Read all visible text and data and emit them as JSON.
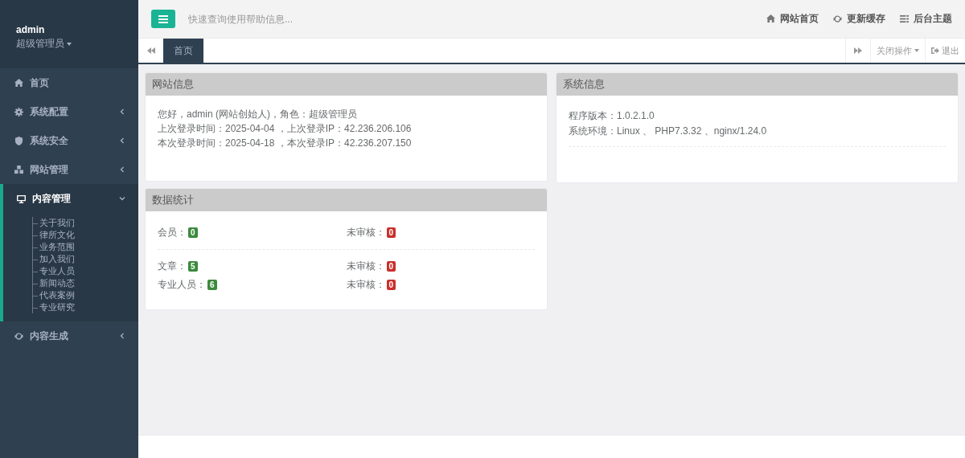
{
  "sidebar": {
    "user": {
      "name": "admin",
      "role": "超级管理员"
    },
    "items": [
      {
        "label": "首页",
        "expanded": false
      },
      {
        "label": "系统配置",
        "expanded": false
      },
      {
        "label": "系统安全",
        "expanded": false
      },
      {
        "label": "网站管理",
        "expanded": false
      },
      {
        "label": "内容管理",
        "expanded": true,
        "children": [
          "关于我们",
          "律所文化",
          "业务范围",
          "加入我们",
          "专业人员",
          "新闻动态",
          "代表案例",
          "专业研究"
        ]
      },
      {
        "label": "内容生成",
        "expanded": false
      }
    ]
  },
  "header": {
    "search": {
      "placeholder": "快速查询使用帮助信息..."
    },
    "links": [
      "网站首页",
      "更新缓存",
      "后台主题"
    ]
  },
  "tabbar": {
    "tabs": [
      {
        "label": "首页",
        "selected": true
      }
    ],
    "close_menu": "关闭操作",
    "logout": "退出"
  },
  "panels": {
    "site_info": {
      "title": "网站信息",
      "lines": [
        "您好，admin (网站创始人)，角色：超级管理员",
        "上次登录时间：2025-04-04 ，上次登录IP：42.236.206.106",
        "本次登录时间：2025-04-18 ，本次登录IP：42.236.207.150"
      ]
    },
    "system_info": {
      "title": "系统信息",
      "rows": [
        {
          "label": "程序版本：",
          "value": "1.0.2.1.0"
        },
        {
          "label": "系统环境：",
          "value": "Linux 、 PHP7.3.32 、nginx/1.24.0"
        }
      ]
    },
    "stats": {
      "title": "数据统计",
      "groups": [
        [
          [
            {
              "label": "会员：",
              "count": "0",
              "color": "#3c8a3e"
            },
            {
              "label": "未审核：",
              "count": "0",
              "color": "#c9302c"
            }
          ]
        ],
        [
          [
            {
              "label": "文章：",
              "count": "5",
              "color": "#3c8a3e"
            },
            {
              "label": "未审核：",
              "count": "0",
              "color": "#c9302c"
            }
          ],
          [
            {
              "label": "专业人员：",
              "count": "6",
              "color": "#3c8a3e"
            },
            {
              "label": "未审核：",
              "count": "0",
              "color": "#c9302c"
            }
          ]
        ]
      ]
    }
  }
}
